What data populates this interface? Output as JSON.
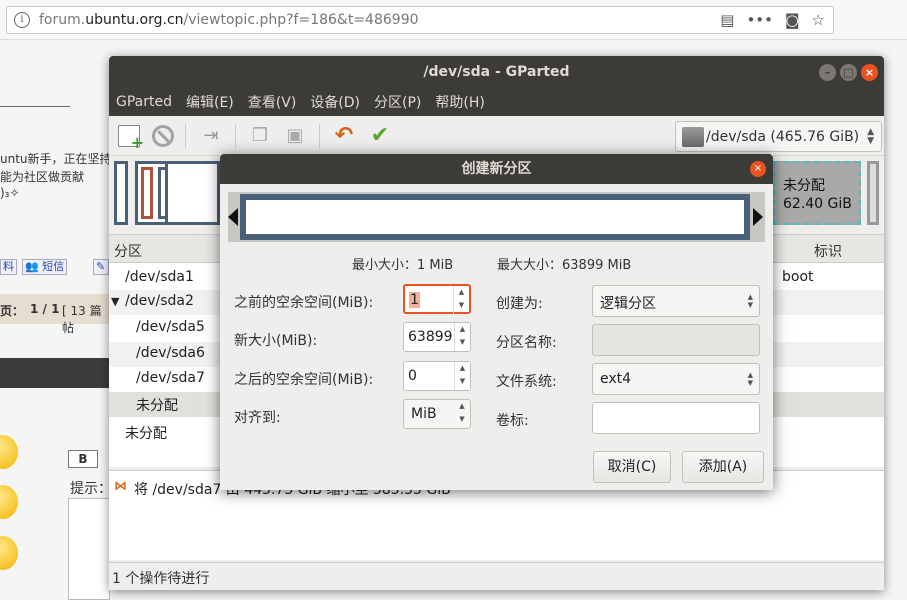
{
  "browser": {
    "url_prefix": "forum.",
    "url_domain": "ubuntu.org.cn",
    "url_path": "/viewtopic.php?f=186&t=486990",
    "icons": [
      "info-icon",
      "reader-icon",
      "more-icon",
      "pocket-icon",
      "star-icon"
    ]
  },
  "forum": {
    "line_a": "untu新手，正在坚持",
    "line_b": "能为社区做贡献",
    "line_c": ")₃✧",
    "btn_profile": "料",
    "btn_pm": "短信",
    "btn_edit": "编辑",
    "pages": "页：",
    "pages_value": "1 / 1",
    "posts": "[ 13 篇帖",
    "bold": "B",
    "hint": "提示："
  },
  "gparted": {
    "title": "/dev/sda - GParted",
    "menu": [
      "GParted",
      "编辑(E)",
      "查看(V)",
      "设备(D)",
      "分区(P)",
      "帮助(H)"
    ],
    "device": "/dev/sda  (465.76 GiB)",
    "unallocated_label": "未分配",
    "unallocated_size": "62.40 GiB",
    "columns": {
      "partition": "分区",
      "flag": "标识"
    },
    "rows": [
      {
        "name": "/dev/sda1",
        "flag": "boot"
      },
      {
        "name": "/dev/sda2",
        "flag": ""
      },
      {
        "name": "/dev/sda5",
        "flag": ""
      },
      {
        "name": "/dev/sda6",
        "flag": ""
      },
      {
        "name": "/dev/sda7",
        "flag": ""
      },
      {
        "name": "未分配",
        "flag": ""
      },
      {
        "name": "未分配",
        "flag": ""
      }
    ],
    "expander": "▼",
    "log_text": "将 /dev/sda7 由 443.73 GiB 缩小至 385.35 GiB",
    "status": "1 个操作待进行"
  },
  "dialog": {
    "title": "创建新分区",
    "min_size": "最小大小：1 MiB",
    "max_size": "最大大小：63899 MiB",
    "labels": {
      "free_before": "之前的空余空间(MiB):",
      "new_size": "新大小(MiB):",
      "free_after": "之后的空余空间(MiB):",
      "align": "对齐到:",
      "create_as": "创建为:",
      "part_name": "分区名称:",
      "filesystem": "文件系统:",
      "label": "卷标:"
    },
    "values": {
      "free_before": "1",
      "new_size": "63899",
      "free_after": "0",
      "align": "MiB",
      "create_as": "逻辑分区",
      "part_name": "",
      "filesystem": "ext4",
      "label": ""
    },
    "cancel": "取消(C)",
    "add": "添加(A)"
  }
}
